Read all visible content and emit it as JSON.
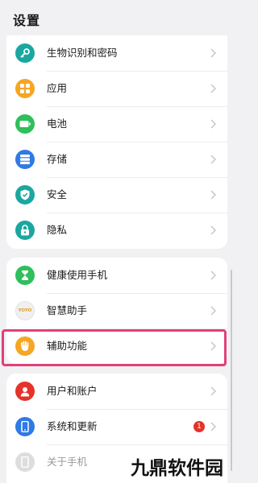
{
  "page_title": "设置",
  "groups": [
    {
      "items": [
        {
          "label": "生物识别和密码",
          "icon": "key-icon",
          "color": "#1ba7a0"
        },
        {
          "label": "应用",
          "icon": "apps-grid-icon",
          "color": "#f5a623"
        },
        {
          "label": "电池",
          "icon": "battery-icon",
          "color": "#2fbf5b"
        },
        {
          "label": "存储",
          "icon": "storage-icon",
          "color": "#2f7ae5"
        },
        {
          "label": "安全",
          "icon": "shield-icon",
          "color": "#1ba7a0"
        },
        {
          "label": "隐私",
          "icon": "lock-icon",
          "color": "#1ba7a0"
        }
      ]
    },
    {
      "items": [
        {
          "label": "健康使用手机",
          "icon": "hourglass-icon",
          "color": "#2fbf5b"
        },
        {
          "label": "智慧助手",
          "icon": "assistant-icon",
          "color": "#f0f0f0",
          "icon_text": "YOYO"
        },
        {
          "label": "辅助功能",
          "icon": "hand-icon",
          "color": "#f5a623"
        }
      ]
    },
    {
      "items": [
        {
          "label": "用户和账户",
          "icon": "user-icon",
          "color": "#e5332a"
        },
        {
          "label": "系统和更新",
          "icon": "phone-update-icon",
          "color": "#2f7ae5",
          "badge": "1"
        },
        {
          "label": "关于手机",
          "icon": "phone-icon",
          "color": "#b5b5b5"
        }
      ]
    }
  ],
  "watermark": "九鼎软件园",
  "colors": {
    "highlight_border": "#e0407a",
    "background": "#f1f1f3"
  }
}
